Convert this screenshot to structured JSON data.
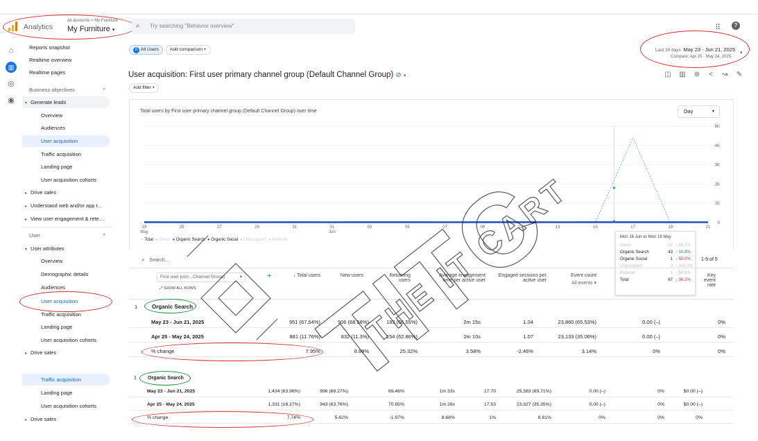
{
  "app": {
    "name": "Analytics",
    "breadcrumb_account": "All accounts",
    "breadcrumb_property": "My Furniture",
    "property": "My Furniture"
  },
  "search": {
    "placeholder": "Try searching \"Behavior overview\""
  },
  "sidebar": {
    "top_items": [
      "Reports snapshot",
      "Realtime overview",
      "Realtime pages"
    ],
    "section1": "Business objectives",
    "generate_leads": "Generate leads",
    "gl_items": [
      "Overview",
      "Audiences",
      "User acquisition",
      "Traffic acquisition",
      "Landing page",
      "User acquisition cohorts"
    ],
    "drive_sales": "Drive sales",
    "understand": "Understand web and/or app t...",
    "view_engagement": "View user engagement & rete...",
    "section2": "User",
    "user_attributes": "User attributes",
    "ua_items": [
      "Overview",
      "Demographic details",
      "Audiences",
      "User acquisition",
      "Traffic acquisition",
      "Landing page",
      "User acquisition cohorts"
    ],
    "drive_sales2": "Drive sales",
    "lower_items": [
      "Traffic acquisition",
      "Landing page",
      "User acquisition cohorts"
    ],
    "drive_sales3": "Drive sales"
  },
  "header": {
    "segment_chip": "All Users",
    "segment_letter": "A",
    "add_comparison": "Add comparison",
    "date_label": "Last 30 days",
    "date_range": "May 23 - Jun 21, 2025",
    "compare": "Compare: Apr 25 - May 24, 2025",
    "title": "User acquisition: First user primary channel group (Default Channel Group)",
    "add_filter": "Add filter"
  },
  "chart_data": {
    "type": "line",
    "title": "Total users by First user primary channel group (Default Channel Group) over time",
    "granularity": "Day",
    "x": [
      "23",
      "25",
      "27",
      "29",
      "31",
      "01",
      "03",
      "05",
      "07",
      "09",
      "11",
      "13",
      "15",
      "17",
      "19",
      "21"
    ],
    "x_month_labels": [
      "May",
      "Jun"
    ],
    "y_ticks": [
      "5K",
      "4K",
      "3K",
      "2K",
      "1K",
      "0"
    ],
    "ylim": [
      0,
      5000
    ],
    "series": [
      {
        "name": "Total",
        "color": "#9aa0a6",
        "values": [
          0,
          0,
          0,
          0,
          0,
          0,
          0,
          0,
          0,
          0,
          0,
          0,
          0,
          0,
          0,
          0
        ]
      },
      {
        "name": "Organic Search",
        "color": "#1a73e8",
        "values": [
          43,
          40,
          42,
          38,
          41,
          40,
          44,
          42,
          39,
          41,
          43,
          40,
          42,
          43,
          41,
          40
        ]
      },
      {
        "name": "Organic Social",
        "color": "#3949ab",
        "values": [
          1,
          1,
          1,
          1,
          1,
          1,
          1,
          1,
          1,
          1,
          1,
          1,
          1,
          1,
          1,
          1
        ]
      }
    ],
    "compare_series": {
      "name": "Total (compare)",
      "color": "#5b9bd5",
      "values": [
        0,
        0,
        0,
        0,
        0,
        0,
        0,
        0,
        0,
        0,
        0,
        0,
        0,
        4400,
        0,
        0
      ],
      "highlight_value": 1800
    },
    "legend": [
      "Total",
      "Direct",
      "Organic Search",
      "Organic Social",
      "Unassigned",
      "Referral"
    ],
    "legend_placement": "bottom-left"
  },
  "tooltip": {
    "title": "Mon 16 Jun vs Mon 19 May",
    "rows": [
      {
        "name": "Direct",
        "value": "22",
        "change": "↓ 98.7%"
      },
      {
        "name": "Organic Search",
        "value": "43",
        "change": "↑ 10.3%"
      },
      {
        "name": "Organic Social",
        "value": "1",
        "change": "↓ 50.0%"
      },
      {
        "name": "Unassigned",
        "value": "0",
        "change": "↑ 100.0%"
      },
      {
        "name": "Referral",
        "value": "1",
        "change": "↓ 50.0%"
      },
      {
        "name": "Total",
        "value": "67",
        "change": "↓ 96.2%"
      }
    ]
  },
  "table": {
    "search_placeholder": "Search...",
    "pagination": "1-5 of 5",
    "dimension": "First user prim...Channel Group)",
    "show_all_rows": "SHOW ALL ROWS",
    "columns": [
      "Total users",
      "New users",
      "Returning users",
      "Average engagement time per active user",
      "Engaged sessions per active user",
      "Event count",
      "Key event rate"
    ],
    "event_sub": "All events",
    "block1": {
      "index": "1",
      "channel": "Organic Search",
      "rows": [
        {
          "label": "May 23 - Jun 21, 2025",
          "vals": [
            "951 (67.64%)",
            "906 (68.58%)",
            "193 (66.55%)",
            "2m 15s",
            "1.04",
            "23,860 (65.53%)",
            "0.00 (–)",
            "0%"
          ]
        },
        {
          "label": "Apr 25 - May 24, 2025",
          "vals": [
            "881 (11.76%)",
            "832 (11.3%)",
            "154 (62.86%)",
            "2m 10s",
            "1.07",
            "23,133 (35.06%)",
            "0.00 (–)",
            "0%"
          ]
        },
        {
          "label": "% change",
          "vals": [
            "7.95%",
            "8.89%",
            "25.32%",
            "3.58%",
            "-2.46%",
            "3.14%",
            "0%",
            "0%"
          ]
        }
      ]
    },
    "block2": {
      "index": "1",
      "channel": "Organic Search",
      "rows": [
        {
          "label": "May 23 - Jun 21, 2025",
          "vals": [
            "1,434 (63.96%)",
            "996 (68.27%)",
            "69.46%",
            "1m 33s",
            "17.70",
            "25,383 (69.71%)",
            "0.00 (–)",
            "0%",
            "$0.00 (–)"
          ]
        },
        {
          "label": "Apr 25 - May 24, 2025",
          "vals": [
            "1,331 (16.27%)",
            "943 (63.76%)",
            "70.85%",
            "1m 26s",
            "17.53",
            "23,327 (35.35%)",
            "0.00 (–)",
            "0%",
            "$0.00 (–)"
          ]
        },
        {
          "label": "% change",
          "vals": [
            "7.74%",
            "5.62%",
            "-1.97%",
            "8.68%",
            "1%",
            "8.81%",
            "0%",
            "0%",
            "0%"
          ]
        }
      ]
    }
  },
  "watermark": "THE IT CART"
}
